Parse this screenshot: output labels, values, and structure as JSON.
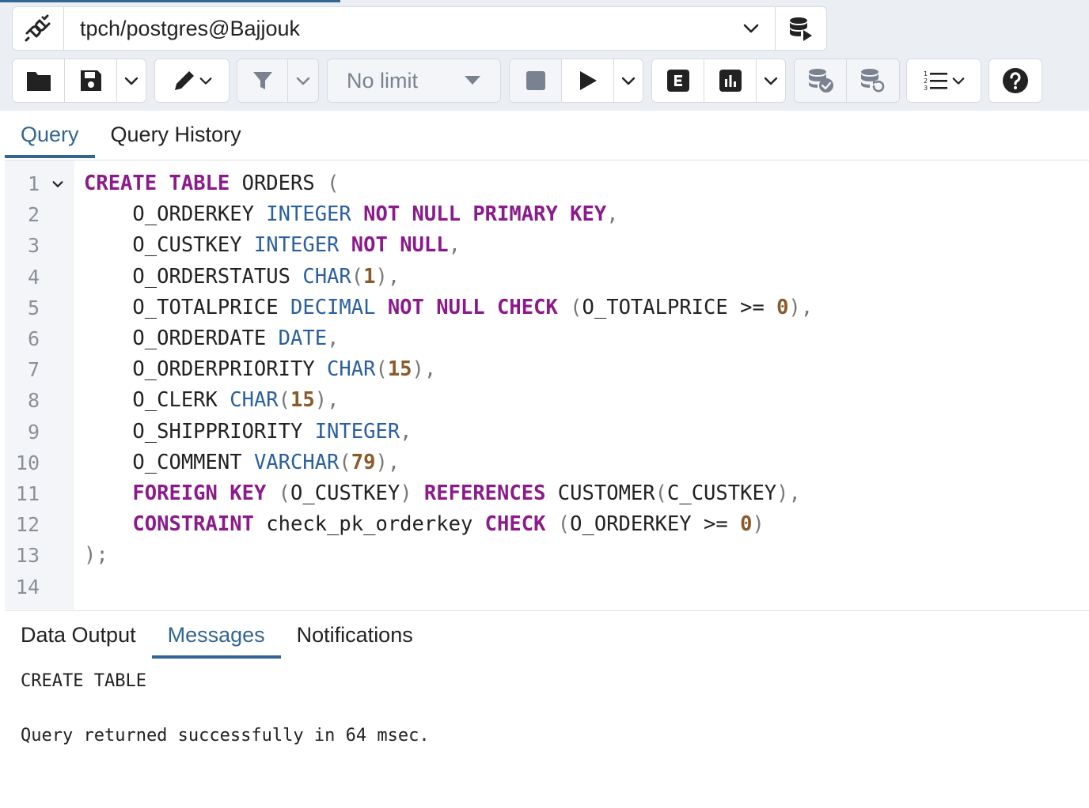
{
  "connection": {
    "label": "tpch/postgres@Bajjouk"
  },
  "toolbar": {
    "limit_label": "No limit"
  },
  "icons": {
    "connection": "plug-disconnected-icon",
    "new_connection": "database-add-icon",
    "open": "folder-icon",
    "save": "save-icon",
    "edit": "pencil-icon",
    "filter": "filter-icon",
    "stop": "stop-icon",
    "execute": "play-icon",
    "explain": "explain-e-icon",
    "analyze": "bar-chart-icon",
    "commit": "database-check-icon",
    "rollback": "database-rollback-icon",
    "macros": "ordered-list-icon",
    "help": "help-circle-icon"
  },
  "query_tabs": [
    "Query",
    "Query History"
  ],
  "result_tabs": [
    "Data Output",
    "Messages",
    "Notifications"
  ],
  "editor": {
    "lines": [
      {
        "n": "1",
        "tokens": [
          [
            "kw",
            "CREATE"
          ],
          [
            "p",
            " "
          ],
          [
            "kw",
            "TABLE"
          ],
          [
            "p",
            " ORDERS "
          ],
          [
            "pn",
            "("
          ]
        ]
      },
      {
        "n": "2",
        "tokens": [
          [
            "p",
            "    O_ORDERKEY "
          ],
          [
            "ty",
            "INTEGER"
          ],
          [
            "p",
            " "
          ],
          [
            "kw",
            "NOT"
          ],
          [
            "p",
            " "
          ],
          [
            "kw",
            "NULL"
          ],
          [
            "p",
            " "
          ],
          [
            "kw",
            "PRIMARY"
          ],
          [
            "p",
            " "
          ],
          [
            "kw",
            "KEY"
          ],
          [
            "pn",
            ","
          ]
        ]
      },
      {
        "n": "3",
        "tokens": [
          [
            "p",
            "    O_CUSTKEY "
          ],
          [
            "ty",
            "INTEGER"
          ],
          [
            "p",
            " "
          ],
          [
            "kw",
            "NOT"
          ],
          [
            "p",
            " "
          ],
          [
            "kw",
            "NULL"
          ],
          [
            "pn",
            ","
          ]
        ]
      },
      {
        "n": "4",
        "tokens": [
          [
            "p",
            "    O_ORDERSTATUS "
          ],
          [
            "ty",
            "CHAR"
          ],
          [
            "pn",
            "("
          ],
          [
            "num",
            "1"
          ],
          [
            "pn",
            "),"
          ]
        ]
      },
      {
        "n": "5",
        "tokens": [
          [
            "p",
            "    O_TOTALPRICE "
          ],
          [
            "ty",
            "DECIMAL"
          ],
          [
            "p",
            " "
          ],
          [
            "kw",
            "NOT"
          ],
          [
            "p",
            " "
          ],
          [
            "kw",
            "NULL"
          ],
          [
            "p",
            " "
          ],
          [
            "kw",
            "CHECK"
          ],
          [
            "p",
            " "
          ],
          [
            "pn",
            "("
          ],
          [
            "p",
            "O_TOTALPRICE >= "
          ],
          [
            "num",
            "0"
          ],
          [
            "pn",
            "),"
          ]
        ]
      },
      {
        "n": "6",
        "tokens": [
          [
            "p",
            "    O_ORDERDATE "
          ],
          [
            "ty",
            "DATE"
          ],
          [
            "pn",
            ","
          ]
        ]
      },
      {
        "n": "7",
        "tokens": [
          [
            "p",
            "    O_ORDERPRIORITY "
          ],
          [
            "ty",
            "CHAR"
          ],
          [
            "pn",
            "("
          ],
          [
            "num",
            "15"
          ],
          [
            "pn",
            "),"
          ]
        ]
      },
      {
        "n": "8",
        "tokens": [
          [
            "p",
            "    O_CLERK "
          ],
          [
            "ty",
            "CHAR"
          ],
          [
            "pn",
            "("
          ],
          [
            "num",
            "15"
          ],
          [
            "pn",
            "),"
          ]
        ]
      },
      {
        "n": "9",
        "tokens": [
          [
            "p",
            "    O_SHIPPRIORITY "
          ],
          [
            "ty",
            "INTEGER"
          ],
          [
            "pn",
            ","
          ]
        ]
      },
      {
        "n": "10",
        "tokens": [
          [
            "p",
            "    O_COMMENT "
          ],
          [
            "ty",
            "VARCHAR"
          ],
          [
            "pn",
            "("
          ],
          [
            "num",
            "79"
          ],
          [
            "pn",
            "),"
          ]
        ]
      },
      {
        "n": "11",
        "tokens": [
          [
            "p",
            "    "
          ],
          [
            "kw",
            "FOREIGN"
          ],
          [
            "p",
            " "
          ],
          [
            "kw",
            "KEY"
          ],
          [
            "p",
            " "
          ],
          [
            "pn",
            "("
          ],
          [
            "p",
            "O_CUSTKEY"
          ],
          [
            "pn",
            ")"
          ],
          [
            "p",
            " "
          ],
          [
            "kw",
            "REFERENCES"
          ],
          [
            "p",
            " CUSTOMER"
          ],
          [
            "pn",
            "("
          ],
          [
            "p",
            "C_CUSTKEY"
          ],
          [
            "pn",
            "),"
          ]
        ]
      },
      {
        "n": "12",
        "tokens": [
          [
            "p",
            "    "
          ],
          [
            "kw",
            "CONSTRAINT"
          ],
          [
            "p",
            " check_pk_orderkey "
          ],
          [
            "kw",
            "CHECK"
          ],
          [
            "p",
            " "
          ],
          [
            "pn",
            "("
          ],
          [
            "p",
            "O_ORDERKEY >= "
          ],
          [
            "num",
            "0"
          ],
          [
            "pn",
            ")"
          ]
        ]
      },
      {
        "n": "13",
        "tokens": [
          [
            "pn",
            ");"
          ]
        ]
      },
      {
        "n": "14",
        "tokens": []
      }
    ]
  },
  "messages": {
    "line1": "CREATE TABLE",
    "line2": "Query returned successfully in 64 msec."
  },
  "colors": {
    "accent": "#326690",
    "keyword": "#8b1a8b",
    "type": "#2a5fa0",
    "number": "#8a5a2b"
  }
}
